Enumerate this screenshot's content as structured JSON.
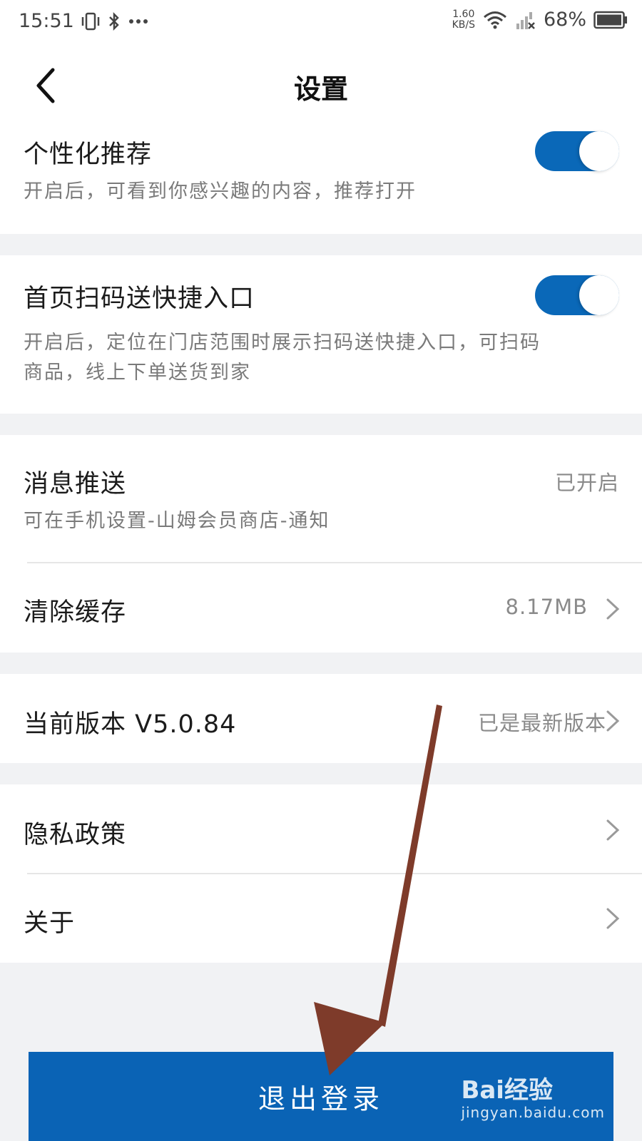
{
  "status_bar": {
    "time": "15:51",
    "speed_value": "1.60",
    "speed_unit": "KB/S",
    "battery_percent": "68%"
  },
  "header": {
    "title": "设置",
    "back_icon": "chevron-left-icon"
  },
  "settings": {
    "personalized": {
      "title": "个性化推荐",
      "description": "开启后，可看到你感兴趣的内容，推荐打开",
      "enabled": true
    },
    "scan_shortcut": {
      "title": "首页扫码送快捷入口",
      "description_line1": "开启后，定位在门店范围时展示扫码送快捷入口，可扫码",
      "description_line2": "商品，线上下单送货到家",
      "enabled": true
    },
    "push": {
      "title": "消息推送",
      "description": "可在手机设置-山姆会员商店-通知",
      "value": "已开启"
    },
    "cache": {
      "title": "清除缓存",
      "value": "8.17MB"
    },
    "version": {
      "title": "当前版本  V5.0.84",
      "value": "已是最新版本"
    },
    "privacy": {
      "title": "隐私政策"
    },
    "about": {
      "title": "关于"
    }
  },
  "logout_button": {
    "label": "退出登录"
  },
  "watermark": {
    "brand": "Bai经验",
    "url": "jingyan.baidu.com"
  },
  "colors": {
    "accent": "#0a63b5",
    "toggle_on": "#0a68b8",
    "background": "#f1f2f4",
    "arrow": "#7e3b2a"
  }
}
